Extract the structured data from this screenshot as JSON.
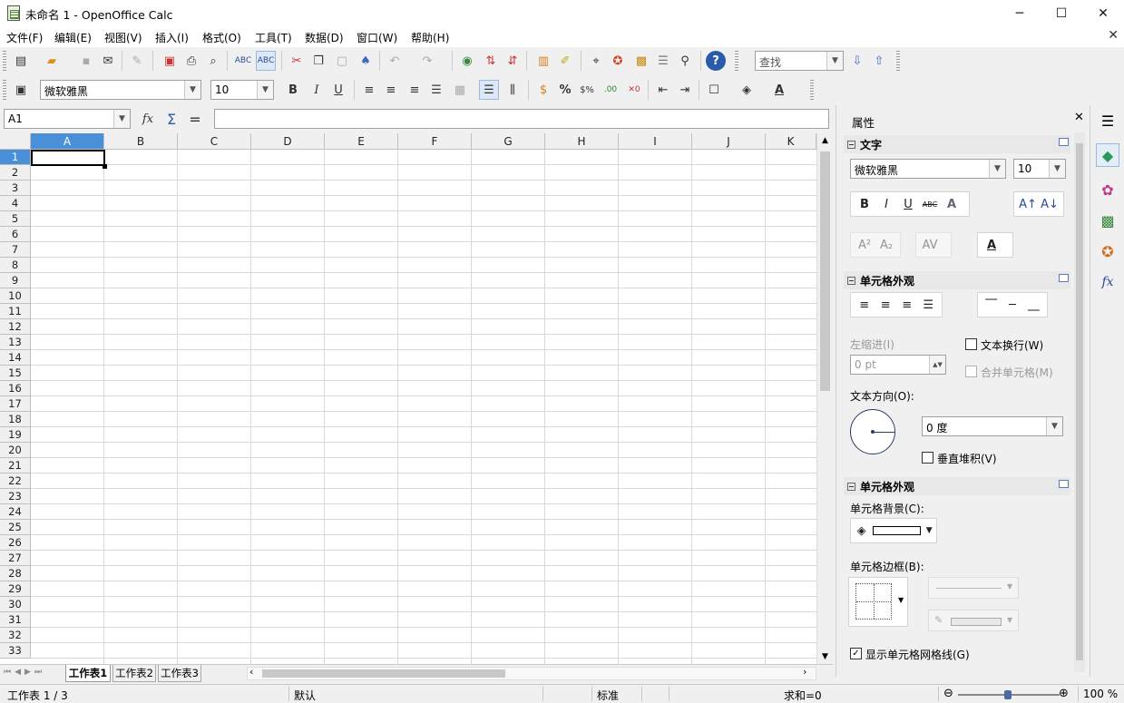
{
  "window": {
    "title": "未命名 1 - OpenOffice Calc",
    "min": "─",
    "max": "☐",
    "close": "✕"
  },
  "menu": [
    "文件(F)",
    "编辑(E)",
    "视图(V)",
    "插入(I)",
    "格式(O)",
    "工具(T)",
    "数据(D)",
    "窗口(W)",
    "帮助(H)"
  ],
  "doc_close": "✕",
  "toolbar": {
    "search_placeholder": "查找",
    "font_name": "微软雅黑",
    "font_size": "10",
    "bold": "B",
    "italic": "I",
    "underline": "U",
    "percent": "%"
  },
  "formula": {
    "namebox": "A1",
    "fx": "fx",
    "sigma": "Σ",
    "equals": "="
  },
  "sheet": {
    "columns": [
      "A",
      "B",
      "C",
      "D",
      "E",
      "F",
      "G",
      "H",
      "I",
      "J",
      "K"
    ],
    "selected_col": "A",
    "selected_row": "1",
    "rows": [
      "1",
      "2",
      "3",
      "4",
      "5",
      "6",
      "7",
      "8",
      "9",
      "10",
      "11",
      "12",
      "13",
      "14",
      "15",
      "16",
      "17",
      "18",
      "19",
      "20",
      "21",
      "22",
      "23",
      "24",
      "25",
      "26",
      "27",
      "28",
      "29",
      "30",
      "31",
      "32",
      "33"
    ],
    "tabs": [
      "工作表1",
      "工作表2",
      "工作表3"
    ]
  },
  "sidebar": {
    "title": "属性",
    "close": "✕",
    "text_section": "文字",
    "font_name": "微软雅黑",
    "font_size": "10",
    "appearance_section": "单元格外观",
    "indent_label": "左缩进(I)",
    "indent_value": "0 pt",
    "wrap_text": "文本换行(W)",
    "merge_cells": "合并单元格(M)",
    "text_direction": "文本方向(O):",
    "angle_value": "0 度",
    "vertical_stack": "垂直堆积(V)",
    "cell_section": "单元格外观",
    "cell_bg": "单元格背景(C):",
    "cell_border": "单元格边框(B):",
    "show_grid": "显示单元格网格线(G)"
  },
  "status": {
    "sheet": "工作表 1 / 3",
    "style": "默认",
    "mode": "标准",
    "sum": "求和=0",
    "zoom": "100 %"
  },
  "colors": {
    "accent": "#4a90d9",
    "grid": "#d8d8d8"
  }
}
